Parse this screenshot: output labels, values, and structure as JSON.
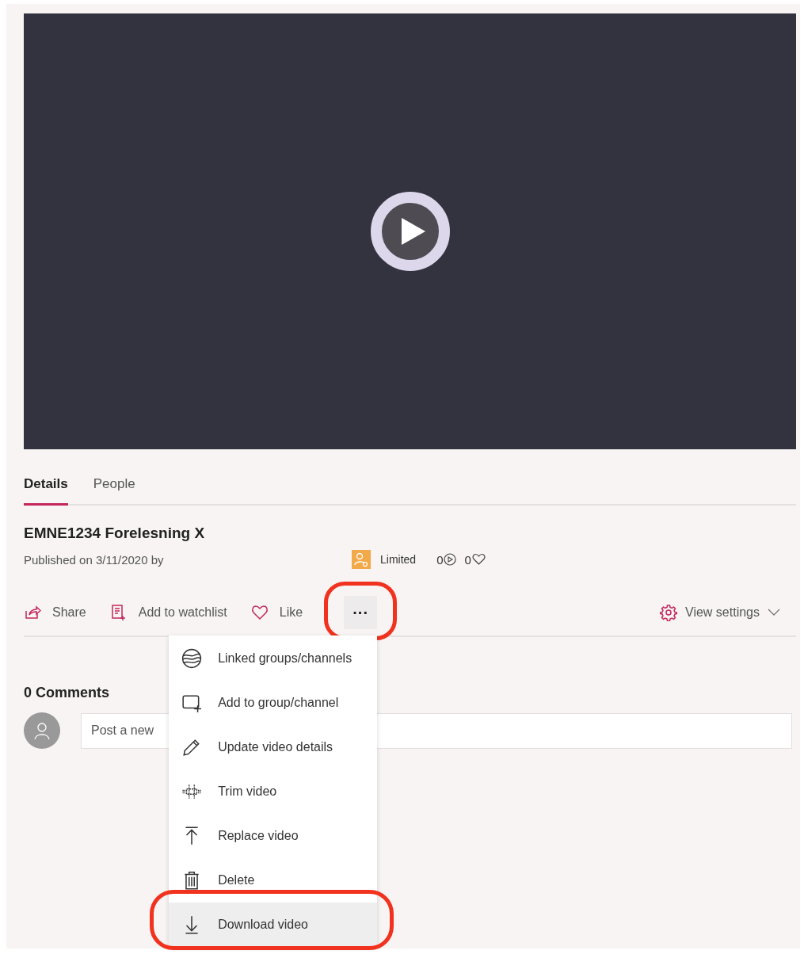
{
  "tabs": [
    {
      "label": "Details",
      "selected": true
    },
    {
      "label": "People",
      "selected": false
    }
  ],
  "video": {
    "title": "EMNE1234 Forelesning X",
    "published": "Published on 3/11/2020 by",
    "permission": "Limited",
    "views": "0",
    "likes": "0"
  },
  "actions": [
    {
      "label": "Share"
    },
    {
      "label": "Add to watchlist"
    },
    {
      "label": "Like"
    }
  ],
  "more_button": {
    "label": "···",
    "highlighted": true
  },
  "view_settings": {
    "label": "View settings"
  },
  "menu": [
    {
      "label": "Linked groups/channels",
      "highlighted": false
    },
    {
      "label": "Add to group/channel",
      "highlighted": false
    },
    {
      "label": "Update video details",
      "highlighted": false
    },
    {
      "label": "Trim video",
      "highlighted": false
    },
    {
      "label": "Replace video",
      "highlighted": false
    },
    {
      "label": "Delete",
      "highlighted": false
    },
    {
      "label": "Download video",
      "highlighted": true
    }
  ],
  "comments": {
    "heading": "0 Comments",
    "placeholder": "Post a new"
  }
}
